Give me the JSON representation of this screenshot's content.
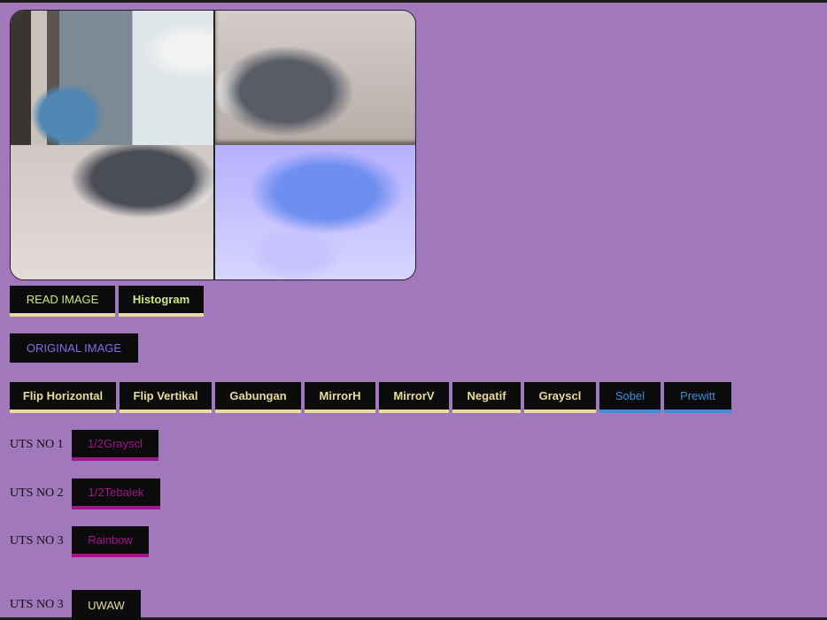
{
  "canvas": {
    "images": [
      "cat-image-top-left",
      "cat-image-top-right",
      "cat-image-bottom-left",
      "cat-image-bottom-right"
    ]
  },
  "buttons": {
    "read_image": "READ IMAGE",
    "histogram": "Histogram",
    "original_image": "ORIGINAL IMAGE",
    "flip_horizontal": "Flip Horizontal",
    "flip_vertikal": "Flip Vertikal",
    "gabungan": "Gabungan",
    "mirror_h": "MirrorH",
    "mirror_v": "MirrorV",
    "negatif": "Negatif",
    "grayscl": "Grayscl",
    "sobel": "Sobel",
    "prewitt": "Prewitt",
    "half_grayscl": "1/2Grayscl",
    "half_tebalek": "1/2Tebalek",
    "rainbow": "Rainbow",
    "uwaw": "UWAW"
  },
  "uts": {
    "no1": "UTS NO 1",
    "no2": "UTS NO 2",
    "no3a": "UTS NO 3",
    "no3b": "UTS NO 3"
  },
  "colors": {
    "page_bg": "#a078bb",
    "button_bg": "#0b0b0b",
    "yellow_text": "#e9dc9a",
    "green_text": "#cce87e",
    "blue_text": "#3b8de0",
    "purple_text": "#a0148c",
    "original_text": "#7b6fe8"
  }
}
